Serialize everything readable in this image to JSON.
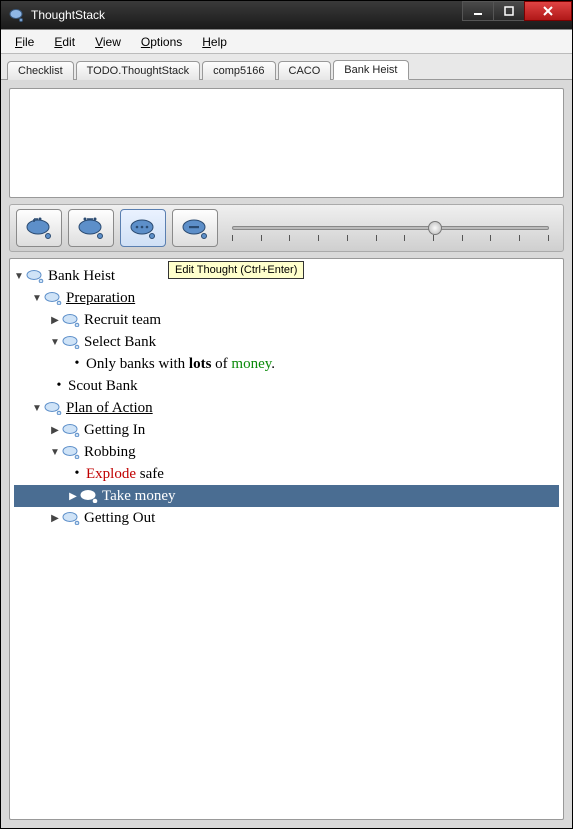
{
  "app_title": "ThoughtStack",
  "menu": {
    "file": "File",
    "edit": "Edit",
    "view": "View",
    "options": "Options",
    "help": "Help"
  },
  "tabs": [
    {
      "label": "Checklist",
      "active": false
    },
    {
      "label": "TODO.ThoughtStack",
      "active": false
    },
    {
      "label": "comp5166",
      "active": false
    },
    {
      "label": "CACO",
      "active": false
    },
    {
      "label": "Bank Heist",
      "active": true
    }
  ],
  "tooltip": "Edit Thought (Ctrl+Enter)",
  "toolbar_icons": [
    "add-child-thought",
    "add-sibling-thought",
    "edit-thought",
    "remove-thought"
  ],
  "tree": {
    "root": "Bank Heist",
    "prep": "Preparation",
    "recruit": "Recruit team",
    "select_bank": "Select Bank",
    "only_banks_pre": "Only banks with ",
    "only_banks_bold": "lots",
    "only_banks_mid": " of ",
    "only_banks_green": "money",
    "only_banks_post": ".",
    "scout": "Scout Bank",
    "plan": "Plan of Action",
    "getting_in": "Getting In",
    "robbing": "Robbing",
    "explode_red": "Explode",
    "explode_rest": " safe",
    "take_money": "Take money",
    "getting_out": "Getting Out"
  },
  "slider": {
    "value": 62,
    "ticks": 12
  }
}
